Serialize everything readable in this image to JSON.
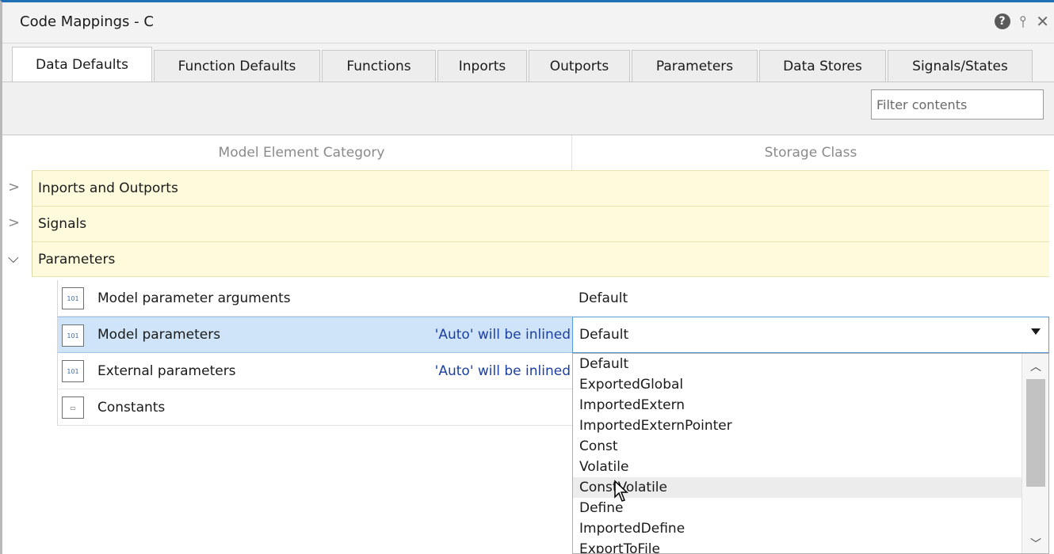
{
  "window": {
    "title": "Code Mappings - C",
    "icons": [
      "help-icon",
      "pin-icon",
      "close-icon"
    ]
  },
  "tabs": [
    {
      "label": "Data Defaults",
      "active": true
    },
    {
      "label": "Function Defaults"
    },
    {
      "label": "Functions"
    },
    {
      "label": "Inports"
    },
    {
      "label": "Outports"
    },
    {
      "label": "Parameters"
    },
    {
      "label": "Data Stores"
    },
    {
      "label": "Signals/States"
    }
  ],
  "toolbar": {
    "filter_placeholder": "Filter contents"
  },
  "table": {
    "headers": {
      "category": "Model Element Category",
      "storage": "Storage Class"
    },
    "groups": [
      {
        "label": "Inports and Outports",
        "expanded": false
      },
      {
        "label": "Signals",
        "expanded": false
      },
      {
        "label": "Parameters",
        "expanded": true
      }
    ],
    "rows": [
      {
        "label": "Model parameter arguments",
        "note": "",
        "storage": "Default",
        "icon": "model-parameter-icon"
      },
      {
        "label": "Model parameters",
        "note": "'Auto' will be inlined",
        "storage": "Default",
        "icon": "model-parameter-icon",
        "selected": true
      },
      {
        "label": "External parameters",
        "note": "'Auto' will be inlined",
        "storage": "",
        "icon": "external-parameter-icon"
      },
      {
        "label": "Constants",
        "note": "",
        "storage": "",
        "icon": "constant-icon"
      }
    ]
  },
  "dropdown": {
    "selected": "Default",
    "options": [
      "Default",
      "ExportedGlobal",
      "ImportedExtern",
      "ImportedExternPointer",
      "Const",
      "Volatile",
      "ConstVolatile",
      "Define",
      "ImportedDefine",
      "ExportToFile"
    ],
    "hover_index": 6
  }
}
